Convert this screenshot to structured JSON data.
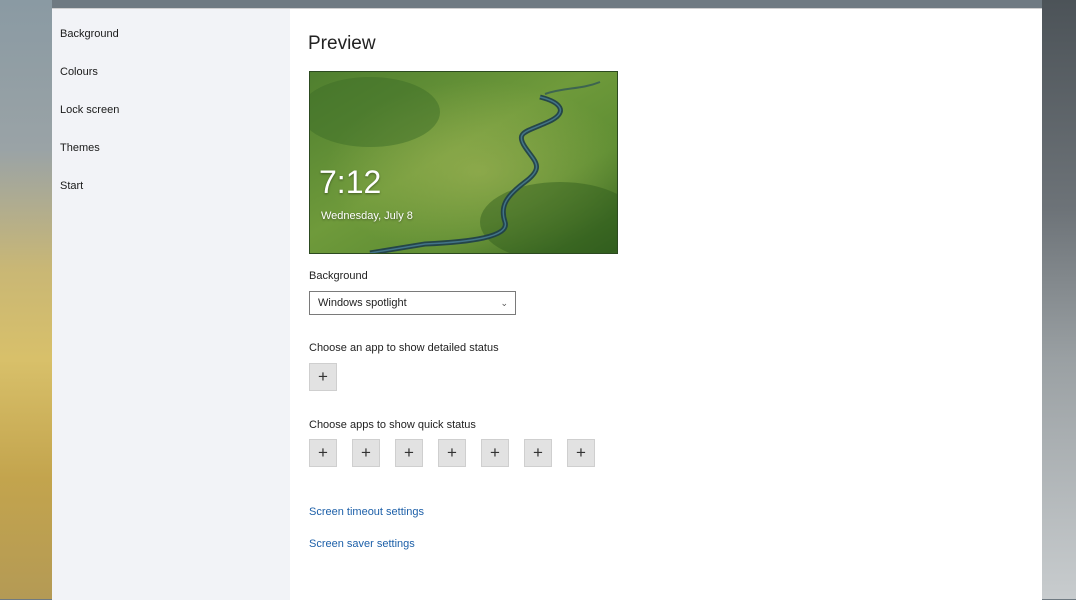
{
  "sidebar": {
    "items": [
      {
        "label": "Background"
      },
      {
        "label": "Colours"
      },
      {
        "label": "Lock screen"
      },
      {
        "label": "Themes"
      },
      {
        "label": "Start"
      }
    ]
  },
  "main": {
    "title": "Preview",
    "preview": {
      "time": "7:12",
      "date": "Wednesday, July 8"
    },
    "background_label": "Background",
    "background_dropdown": {
      "selected": "Windows spotlight"
    },
    "detailed_status_label": "Choose an app to show detailed status",
    "quick_status_label": "Choose apps to show quick status",
    "plus_symbol": "+",
    "links": {
      "screen_timeout": "Screen timeout settings",
      "screen_saver": "Screen saver settings"
    }
  },
  "colors": {
    "sidebar_bg": "#f2f3f7",
    "link": "#1c5fa8",
    "tile_bg": "#e2e2e2"
  }
}
